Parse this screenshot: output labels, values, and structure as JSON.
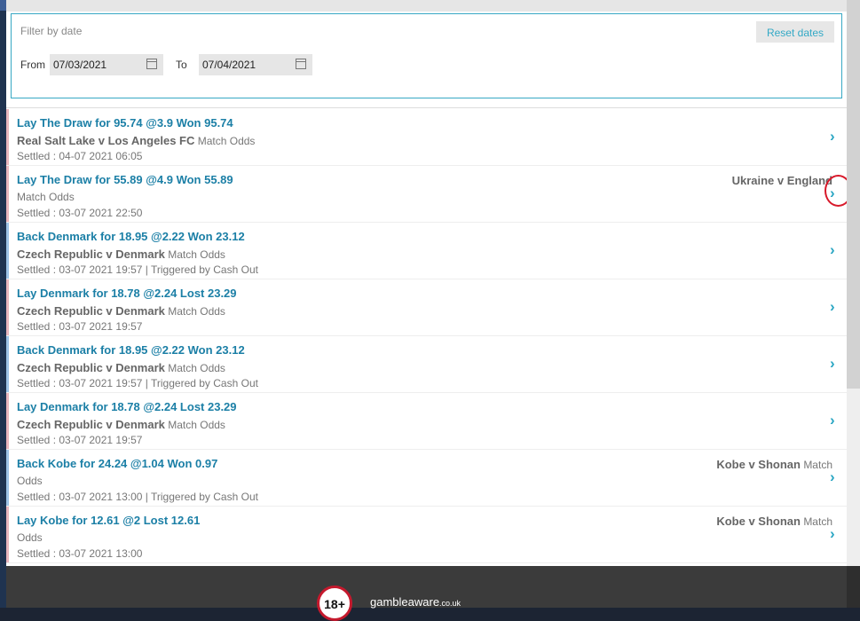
{
  "filter": {
    "label": "Filter by date",
    "reset_label": "Reset dates",
    "from_label": "From",
    "from_value": "07/03/2021",
    "to_label": "To",
    "to_value": "07/04/2021"
  },
  "items": [
    {
      "title": "Lay The Draw for 95.74 @3.9 Won 95.74",
      "event": "Real Salt Lake v Los Angeles FC",
      "market": "Match Odds",
      "market_line2": "",
      "settled": "Settled : 04-07 2021 06:05",
      "bar_color": "#e9b6bd"
    },
    {
      "title": "Lay The Draw for 55.89 @4.9 Won 55.89",
      "event": "Ukraine v England",
      "market": "",
      "market_line2": "Match Odds",
      "settled": "Settled : 03-07 2021 22:50",
      "bar_color": "#e9b6bd"
    },
    {
      "title": "Back Denmark for 18.95 @2.22 Won 23.12",
      "event": "Czech Republic v Denmark",
      "market": "Match Odds",
      "market_line2": "",
      "settled": "Settled : 03-07 2021 19:57 | Triggered by Cash Out",
      "bar_color": "#9ec3e6"
    },
    {
      "title": "Lay Denmark for 18.78 @2.24 Lost 23.29",
      "event": "Czech Republic v Denmark",
      "market": "Match Odds",
      "market_line2": "",
      "settled": "Settled : 03-07 2021 19:57",
      "bar_color": "#e9b6bd"
    },
    {
      "title": "Back Denmark for 18.95 @2.22 Won 23.12",
      "event": "Czech Republic v Denmark",
      "market": "Match Odds",
      "market_line2": "",
      "settled": "Settled : 03-07 2021 19:57 | Triggered by Cash Out",
      "bar_color": "#9ec3e6"
    },
    {
      "title": "Lay Denmark for 18.78 @2.24 Lost 23.29",
      "event": "Czech Republic v Denmark",
      "market": "Match Odds",
      "market_line2": "",
      "settled": "Settled : 03-07 2021 19:57",
      "bar_color": "#e9b6bd"
    },
    {
      "title": "Back Kobe for 24.24 @1.04 Won 0.97",
      "event": "Kobe v Shonan",
      "market": "Match",
      "market_line2": "Odds",
      "settled": "Settled : 03-07 2021 13:00 | Triggered by Cash Out",
      "bar_color": "#9ec3e6"
    },
    {
      "title": "Lay Kobe for 12.61 @2 Lost 12.61",
      "event": "Kobe v Shonan",
      "market": "Match",
      "market_line2": "Odds",
      "settled": "Settled : 03-07 2021 13:00",
      "bar_color": "#e9b6bd"
    }
  ],
  "footer": {
    "age_badge": "18+",
    "brand": "gambleaware",
    "brand_suffix": ".co.uk"
  },
  "icons": {
    "chevron": "chevron-right-icon",
    "calendar": "calendar-icon"
  },
  "colors": {
    "accent": "#33a9c6",
    "link": "#1b7fa6",
    "annotation": "#d8192a"
  }
}
